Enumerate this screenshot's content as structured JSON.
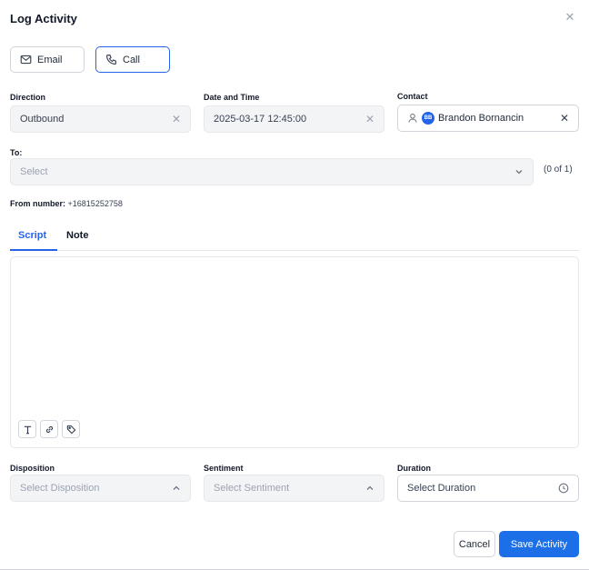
{
  "dialog": {
    "title": "Log Activity",
    "close_icon": "close-icon"
  },
  "activity_type": {
    "email_label": "Email",
    "call_label": "Call",
    "selected": "Call"
  },
  "direction": {
    "label": "Direction",
    "value": "Outbound"
  },
  "datetime": {
    "label": "Date and Time",
    "value": "2025-03-17 12:45:00"
  },
  "contact": {
    "label": "Contact",
    "avatar_initials": "BB",
    "name": "Brandon Bornancin"
  },
  "to": {
    "label": "To:",
    "placeholder": "Select",
    "counter": "(0 of 1)"
  },
  "from": {
    "label": "From number:",
    "value": "+16815252758"
  },
  "tabs": [
    {
      "label": "Script"
    },
    {
      "label": "Note"
    }
  ],
  "active_tab": "Script",
  "editor": {
    "tools": [
      "text-format-icon",
      "link-icon",
      "tag-icon"
    ]
  },
  "disposition": {
    "label": "Disposition",
    "placeholder": "Select Disposition"
  },
  "sentiment": {
    "label": "Sentiment",
    "placeholder": "Select Sentiment"
  },
  "duration": {
    "label": "Duration",
    "placeholder": "Select Duration"
  },
  "footer": {
    "cancel_label": "Cancel",
    "save_label": "Save Activity"
  },
  "colors": {
    "accent": "#2563eb",
    "save_button": "#1d6fe8",
    "field_bg": "#f3f4f6"
  }
}
